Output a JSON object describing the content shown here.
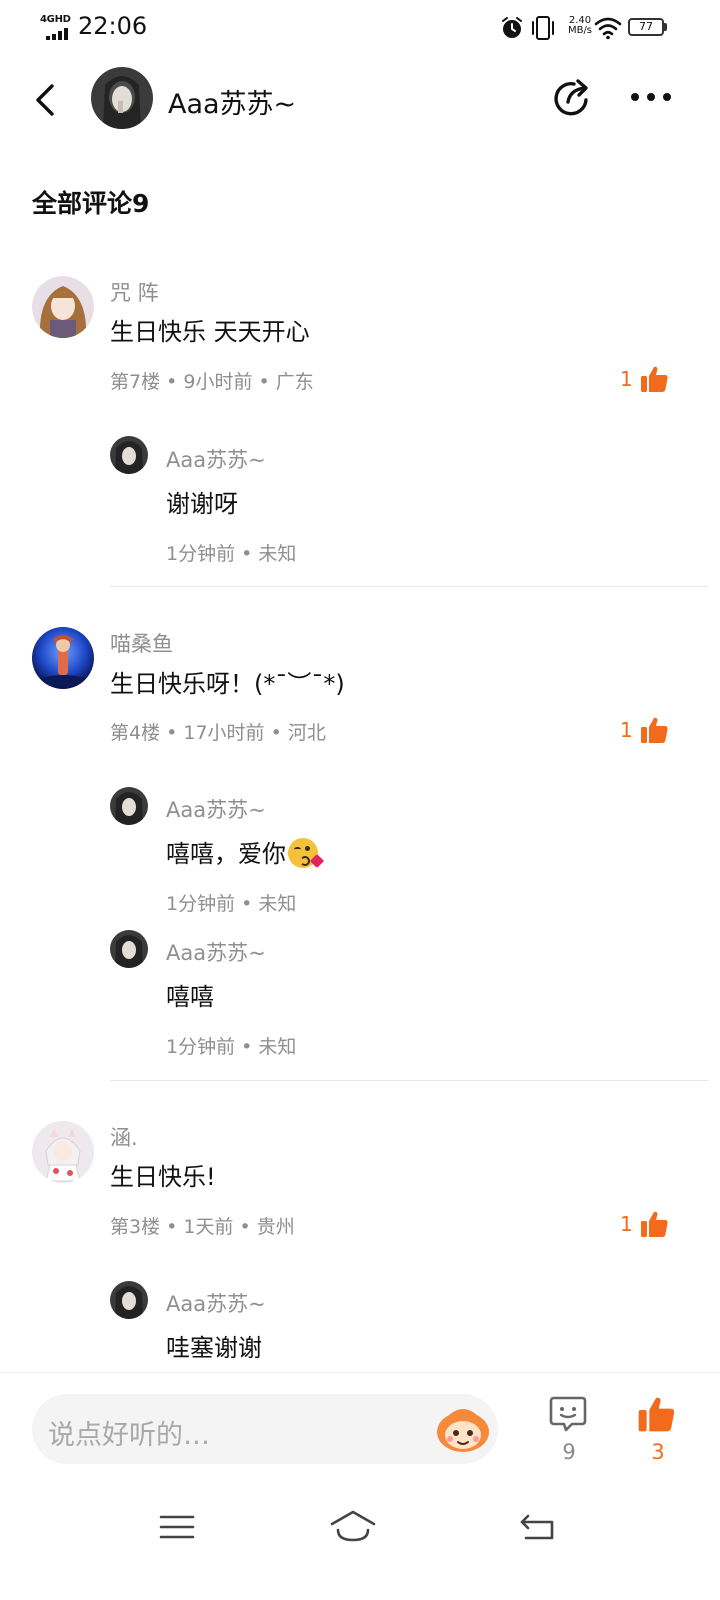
{
  "status_bar": {
    "network": "4GHD",
    "time": "22:06",
    "speed_value": "2.40",
    "speed_unit": "MB/s",
    "battery": "77",
    "icons": [
      "alarm-icon",
      "vibrate-icon",
      "wifi-icon",
      "battery-icon"
    ]
  },
  "header": {
    "title": "Aaa苏苏~",
    "icons": [
      "back-icon",
      "share-icon",
      "more-icon"
    ]
  },
  "comments_section": {
    "title": "全部评论9"
  },
  "comments": [
    {
      "name": "咒 阵",
      "text": "生日快乐 天天开心",
      "meta": "第7楼 • 9小时前 • 广东",
      "likes": "1",
      "replies": [
        {
          "name": "Aaa苏苏~",
          "text": "谢谢呀",
          "meta": "1分钟前 • 未知"
        }
      ]
    },
    {
      "name": "喵桑鱼",
      "text": "生日快乐呀！(*¯︶¯*)",
      "meta": "第4楼 • 17小时前 • 河北",
      "likes": "1",
      "replies": [
        {
          "name": "Aaa苏苏~",
          "text": "嘻嘻，爱你",
          "emoji": "kissing-face-icon",
          "meta": "1分钟前 • 未知"
        },
        {
          "name": "Aaa苏苏~",
          "text": "嘻嘻",
          "meta": "1分钟前 • 未知"
        }
      ]
    },
    {
      "name": "涵.",
      "text": "生日快乐!",
      "meta": "第3楼 • 1天前 • 贵州",
      "likes": "1",
      "replies": [
        {
          "name": "Aaa苏苏~",
          "text": "哇塞谢谢"
        }
      ]
    }
  ],
  "bottom_bar": {
    "input_placeholder": "说点好听的…",
    "comment_count": "9",
    "like_count": "3",
    "icons": [
      "mascot-emoji-icon",
      "comment-icon",
      "thumbs-up-icon"
    ]
  },
  "nav_bar": {
    "icons": [
      "menu-icon",
      "home-icon",
      "back-nav-icon"
    ]
  },
  "colors": {
    "accent": "#f26b1d",
    "secondary_text": "#8f8f8f",
    "primary_text": "#111111",
    "input_bg": "#f4f4f4"
  }
}
